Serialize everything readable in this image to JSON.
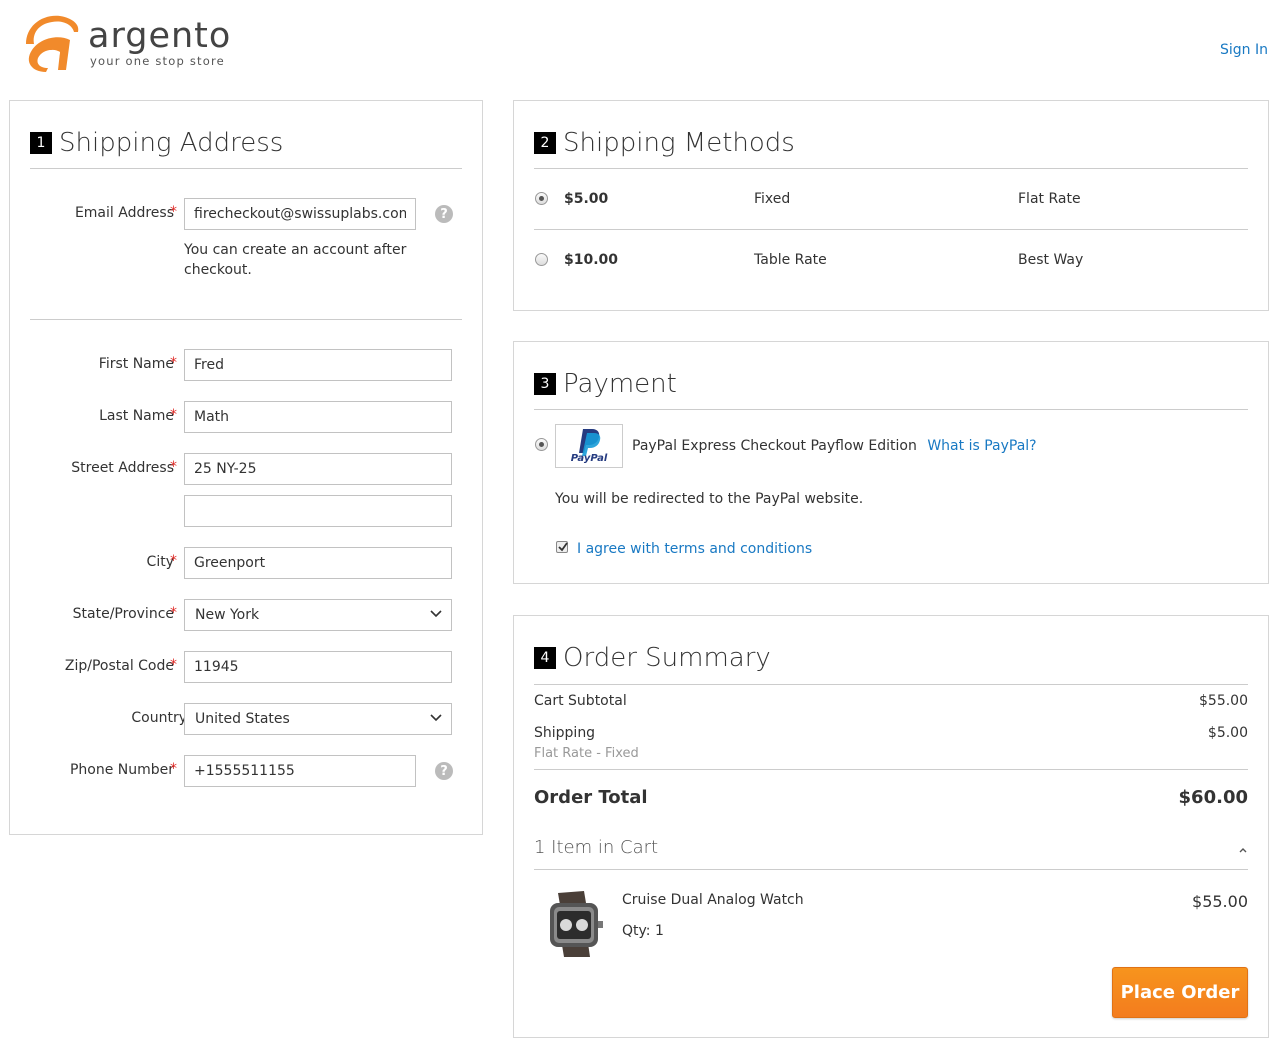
{
  "header": {
    "logo_text": "argento",
    "logo_tagline": "your one stop store",
    "signin_label": "Sign In",
    "brand_orange": "#f18a2b"
  },
  "shipping_address": {
    "step": "1",
    "title": "Shipping Address",
    "email": {
      "label": "Email Address",
      "value": "firecheckout@swissuplabs.com",
      "note": "You can create an account after checkout."
    },
    "first_name": {
      "label": "First Name",
      "value": "Fred"
    },
    "last_name": {
      "label": "Last Name",
      "value": "Math"
    },
    "street": {
      "label": "Street Address",
      "value": "25 NY-25",
      "value2": ""
    },
    "city": {
      "label": "City",
      "value": "Greenport"
    },
    "state": {
      "label": "State/Province",
      "value": "New York"
    },
    "zip": {
      "label": "Zip/Postal Code",
      "value": "11945"
    },
    "country": {
      "label": "Country",
      "value": "United States"
    },
    "phone": {
      "label": "Phone Number",
      "value": "+1555511155"
    },
    "required_mark": "*",
    "help_mark": "?"
  },
  "shipping_methods": {
    "step": "2",
    "title": "Shipping Methods",
    "options": [
      {
        "price": "$5.00",
        "method": "Fixed",
        "carrier": "Flat Rate",
        "selected": true
      },
      {
        "price": "$10.00",
        "method": "Table Rate",
        "carrier": "Best Way",
        "selected": false
      }
    ]
  },
  "payment": {
    "step": "3",
    "title": "Payment",
    "method_label": "PayPal Express Checkout Payflow Edition",
    "what_is_link": "What is PayPal?",
    "logo_text": "PayPal",
    "redirect_note": "You will be redirected to the PayPal website.",
    "terms_label": "I agree with terms and conditions",
    "terms_checked": true
  },
  "order_summary": {
    "step": "4",
    "title": "Order Summary",
    "subtotal_label": "Cart Subtotal",
    "subtotal_value": "$55.00",
    "shipping_label": "Shipping",
    "shipping_sub": "Flat Rate - Fixed",
    "shipping_value": "$5.00",
    "total_label": "Order Total",
    "total_value": "$60.00",
    "items_in_cart": "1 Item in Cart",
    "item": {
      "name": "Cruise Dual Analog Watch",
      "qty": "Qty: 1",
      "price": "$55.00"
    },
    "place_order_label": "Place Order",
    "button_color": "#f68a22"
  }
}
